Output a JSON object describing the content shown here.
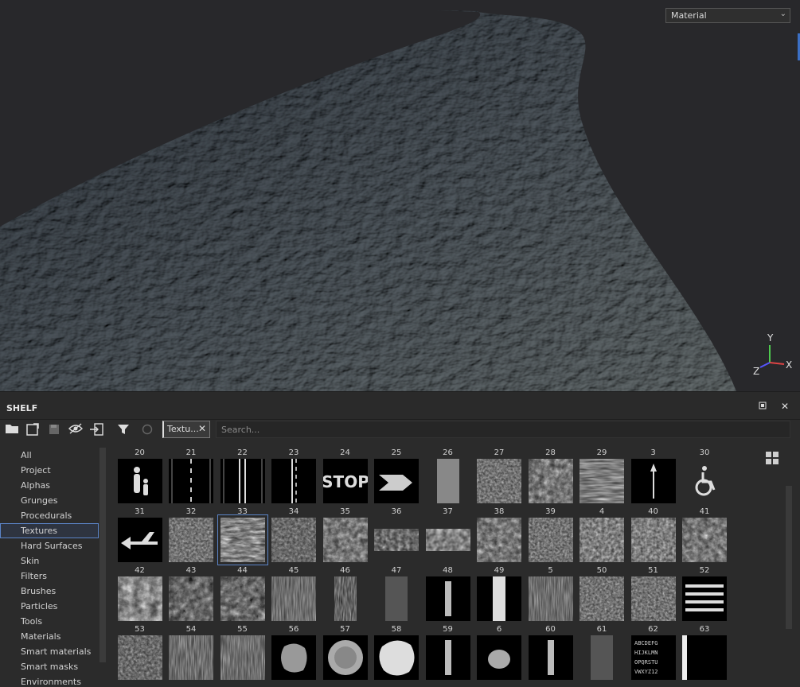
{
  "viewport": {
    "mode_select": "Material",
    "gizmo": {
      "y": "Y",
      "z": "Z",
      "x": "X"
    }
  },
  "shelf": {
    "title": "SHELF",
    "header_icons": [
      "restore-window-icon",
      "close-icon"
    ],
    "toolbar_icons": [
      "folder-icon",
      "new-tab-icon",
      "save-disk-icon",
      "hide-eye-icon",
      "import-icon"
    ],
    "filter_chip": "Textu...",
    "search_placeholder": "Search...",
    "categories": [
      "All",
      "Project",
      "Alphas",
      "Grunges",
      "Procedurals",
      "Textures",
      "Hard Surfaces",
      "Skin",
      "Filters",
      "Brushes",
      "Particles",
      "Tools",
      "Materials",
      "Smart materials",
      "Smart masks",
      "Environments"
    ],
    "active_category": "Textures",
    "items": [
      {
        "label": "20",
        "kind": "people"
      },
      {
        "label": "21",
        "kind": "line-dash"
      },
      {
        "label": "22",
        "kind": "line-double"
      },
      {
        "label": "23",
        "kind": "line-dash2"
      },
      {
        "label": "24",
        "kind": "stop"
      },
      {
        "label": "25",
        "kind": "chevron"
      },
      {
        "label": "26",
        "kind": "strip"
      },
      {
        "label": "27",
        "kind": "noise-mid"
      },
      {
        "label": "28",
        "kind": "noise-rough"
      },
      {
        "label": "29",
        "kind": "waves"
      },
      {
        "label": "3",
        "kind": "arrow"
      },
      {
        "label": "30",
        "kind": "wheelchair"
      },
      {
        "label": "31",
        "kind": "arrow-left"
      },
      {
        "label": "32",
        "kind": "noise-mid"
      },
      {
        "label": "33",
        "kind": "noise-scratch",
        "selected": true
      },
      {
        "label": "34",
        "kind": "noise-dark"
      },
      {
        "label": "35",
        "kind": "noise-rough"
      },
      {
        "label": "36",
        "kind": "band-dark"
      },
      {
        "label": "37",
        "kind": "band-light"
      },
      {
        "label": "38",
        "kind": "noise-rough"
      },
      {
        "label": "39",
        "kind": "noise-mid"
      },
      {
        "label": "4",
        "kind": "noise-light"
      },
      {
        "label": "40",
        "kind": "noise-light"
      },
      {
        "label": "41",
        "kind": "noise-rough"
      },
      {
        "label": "42",
        "kind": "grunge-light"
      },
      {
        "label": "43",
        "kind": "grunge-dark"
      },
      {
        "label": "44",
        "kind": "grunge-dark"
      },
      {
        "label": "45",
        "kind": "streaks"
      },
      {
        "label": "46",
        "kind": "streak-single"
      },
      {
        "label": "47",
        "kind": "strip-dark"
      },
      {
        "label": "48",
        "kind": "thin-bar"
      },
      {
        "label": "49",
        "kind": "bar-wide"
      },
      {
        "label": "5",
        "kind": "streaks"
      },
      {
        "label": "50",
        "kind": "noise-mid"
      },
      {
        "label": "51",
        "kind": "noise-mid"
      },
      {
        "label": "52",
        "kind": "stripes-h"
      },
      {
        "label": "53",
        "kind": "noise-dark"
      },
      {
        "label": "54",
        "kind": "streaks"
      },
      {
        "label": "55",
        "kind": "streaks"
      },
      {
        "label": "56",
        "kind": "blob-dark"
      },
      {
        "label": "57",
        "kind": "blob-mid"
      },
      {
        "label": "58",
        "kind": "blob-light"
      },
      {
        "label": "59",
        "kind": "thin-bar"
      },
      {
        "label": "6",
        "kind": "blob-small"
      },
      {
        "label": "60",
        "kind": "thin-bar"
      },
      {
        "label": "61",
        "kind": "strip-dark"
      },
      {
        "label": "62",
        "kind": "letters"
      },
      {
        "label": "63",
        "kind": "edge-bar"
      }
    ],
    "view_toggle_icon": "grid-view-icon"
  },
  "colors": {
    "accent": "#5b84c8",
    "panel": "#2b2b2b",
    "viewport": "#28282b"
  }
}
